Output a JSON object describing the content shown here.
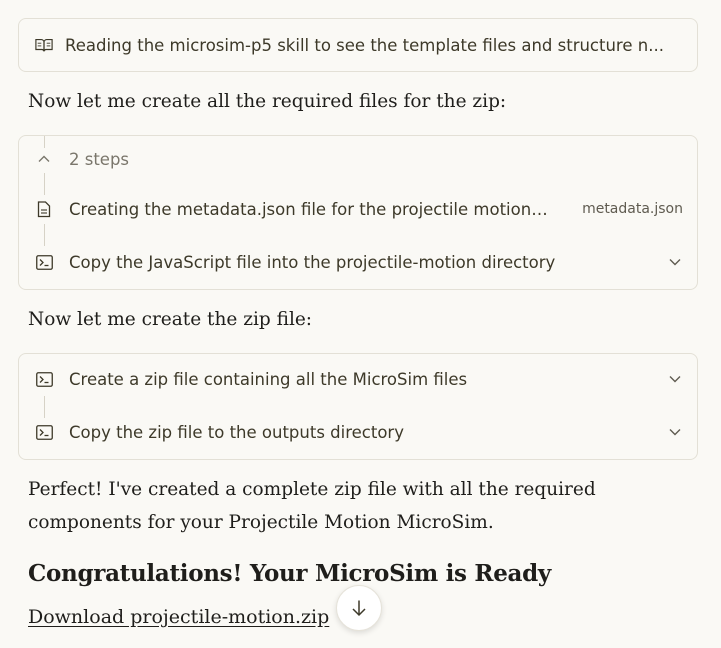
{
  "reading_card": {
    "text": "Reading the microsim-p5 skill to see the template files and structure n..."
  },
  "prose_1": "Now let me create all the required files for the zip:",
  "steps_card_1": {
    "toggle_label": "2 steps",
    "items": [
      {
        "label": "Creating the metadata.json file for the projectile motion ...",
        "file": "metadata.json",
        "icon": "file-icon"
      },
      {
        "label": "Copy the JavaScript file into the projectile-motion directory",
        "icon": "terminal-icon"
      }
    ]
  },
  "prose_2": "Now let me create the zip file:",
  "steps_card_2": {
    "items": [
      {
        "label": "Create a zip file containing all the MicroSim files",
        "icon": "terminal-icon"
      },
      {
        "label": "Copy the zip file to the outputs directory",
        "icon": "terminal-icon"
      }
    ]
  },
  "prose_3_line1": "Perfect! I've created a complete zip file with all the required",
  "prose_3_line2": "components for your Projectile Motion MicroSim.",
  "heading": "Congratulations! Your MicroSim is Ready",
  "download_link": "Download projectile-motion.zip"
}
